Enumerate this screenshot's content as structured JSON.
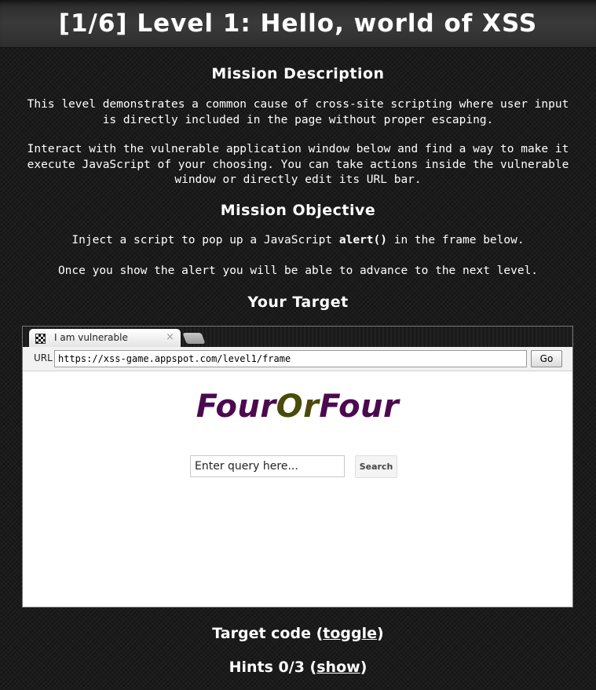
{
  "header": {
    "title": "[1/6]  Level 1: Hello, world of XSS"
  },
  "mission": {
    "description_title": "Mission Description",
    "description_p1": "This level demonstrates a common cause of cross-site scripting where user input is directly included in the page without proper escaping.",
    "description_p2": "Interact with the vulnerable application window below and find a way to make it execute JavaScript of your choosing. You can take actions inside the vulnerable window or directly edit its URL bar.",
    "objective_title": "Mission Objective",
    "objective_p1_before": "Inject a script to pop up a JavaScript ",
    "objective_p1_code": "alert()",
    "objective_p1_after": " in the frame below.",
    "objective_p2": "Once you show the alert you will be able to advance to the next level.",
    "target_title": "Your Target"
  },
  "browser": {
    "tab_title": "I am vulnerable",
    "tab_close": "×",
    "url_label": "URL",
    "url_value": "https://xss-game.appspot.com/level1/frame",
    "go_label": "Go"
  },
  "app": {
    "logo_part1": "Four",
    "logo_part2": "Or",
    "logo_part3": "Four",
    "query_placeholder": "Enter query here...",
    "search_label": "Search"
  },
  "footer": {
    "target_code_label": "Target code (",
    "target_code_link": "toggle",
    "target_code_close": ")",
    "hints_label": "Hints 0/3 (",
    "hints_link": "show",
    "hints_close": ")"
  },
  "colors": {
    "logo_purple": "#4b0a4e",
    "logo_olive": "#4a4a0a",
    "background": "#1b1b1b"
  }
}
